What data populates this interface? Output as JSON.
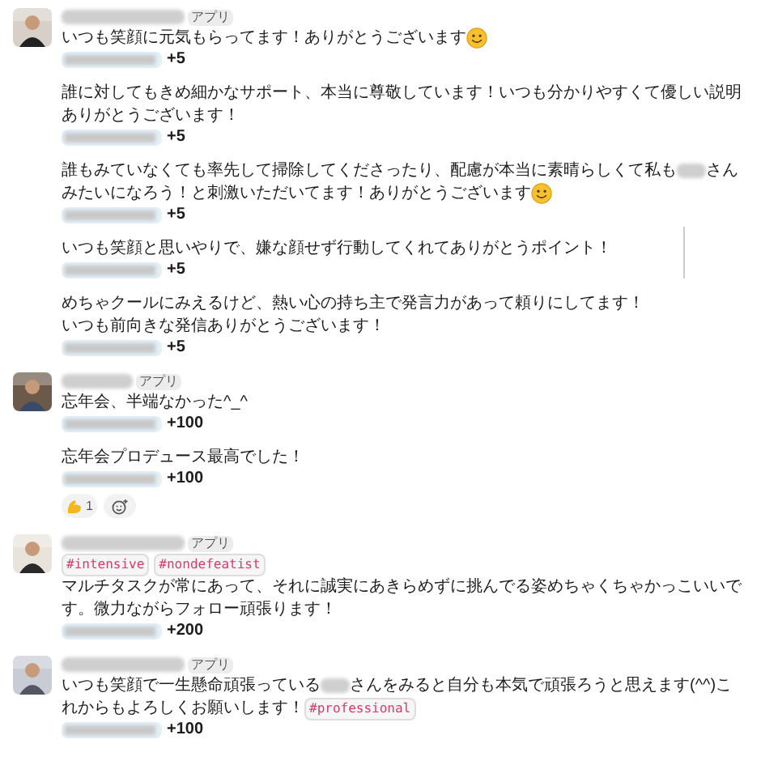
{
  "messages": [
    {
      "badge": "アプリ",
      "entries": [
        {
          "lines": [
            [
              {
                "kind": "text",
                "text": "いつも笑顔に元気もらってます！ありがとうございます"
              },
              {
                "kind": "emoji"
              }
            ]
          ],
          "points": "+5"
        },
        {
          "lines": [
            [
              {
                "kind": "text",
                "text": "誰に対してもきめ細かなサポート、本当に尊敬しています！いつも分かりやすくて優しい説明"
              }
            ],
            [
              {
                "kind": "text",
                "text": "ありがとうございます！"
              }
            ]
          ],
          "points": "+5"
        },
        {
          "lines": [
            [
              {
                "kind": "text",
                "text": "誰もみていなくても率先して掃除してくださったり、配慮が本当に素晴らしくて私も"
              },
              {
                "kind": "redacted"
              },
              {
                "kind": "text",
                "text": "さん"
              }
            ],
            [
              {
                "kind": "text",
                "text": "みたいになろう！と刺激いただいてます！ありがとうございます"
              },
              {
                "kind": "emoji"
              }
            ]
          ],
          "points": "+5"
        },
        {
          "lines": [
            [
              {
                "kind": "text",
                "text": "いつも笑顔と思いやりで、嫌な顔せず行動してくれてありがとうポイント！"
              }
            ]
          ],
          "points": "+5"
        },
        {
          "lines": [
            [
              {
                "kind": "text",
                "text": "めちゃクールにみえるけど、熱い心の持ち主で発言力があって頼りにしてます！"
              }
            ],
            [
              {
                "kind": "text",
                "text": "いつも前向きな発信ありがとうございます！"
              }
            ]
          ],
          "points": "+5"
        }
      ]
    },
    {
      "badge": "アプリ",
      "entries": [
        {
          "lines": [
            [
              {
                "kind": "text",
                "text": "忘年会、半端なかった^_^"
              }
            ]
          ],
          "points": "+100"
        },
        {
          "lines": [
            [
              {
                "kind": "text",
                "text": "忘年会プロデュース最高でした！"
              }
            ]
          ],
          "points": "+100"
        }
      ],
      "reactions": [
        {
          "count": "1"
        }
      ]
    },
    {
      "badge": "アプリ",
      "entries": [
        {
          "lines": [
            [
              {
                "kind": "tag",
                "text": "#intensive"
              },
              {
                "kind": "tag",
                "text": "#nondefeatist"
              }
            ],
            [
              {
                "kind": "text",
                "text": "マルチタスクが常にあって、それに誠実にあきらめずに挑んでる姿めちゃくちゃかっこいいで"
              }
            ],
            [
              {
                "kind": "text",
                "text": "す。微力ながらフォロー頑張ります！"
              }
            ]
          ],
          "points": "+200"
        }
      ]
    },
    {
      "badge": "アプリ",
      "entries": [
        {
          "lines": [
            [
              {
                "kind": "text",
                "text": "いつも笑顔で一生懸命頑張っている"
              },
              {
                "kind": "redacted"
              },
              {
                "kind": "text",
                "text": "さんをみると自分も本気で頑張ろうと思えます(^^)こ"
              }
            ],
            [
              {
                "kind": "text",
                "text": "れからもよろしくお願いします！"
              },
              {
                "kind": "tag",
                "text": "#professional"
              }
            ]
          ],
          "points": "+100"
        }
      ]
    }
  ]
}
